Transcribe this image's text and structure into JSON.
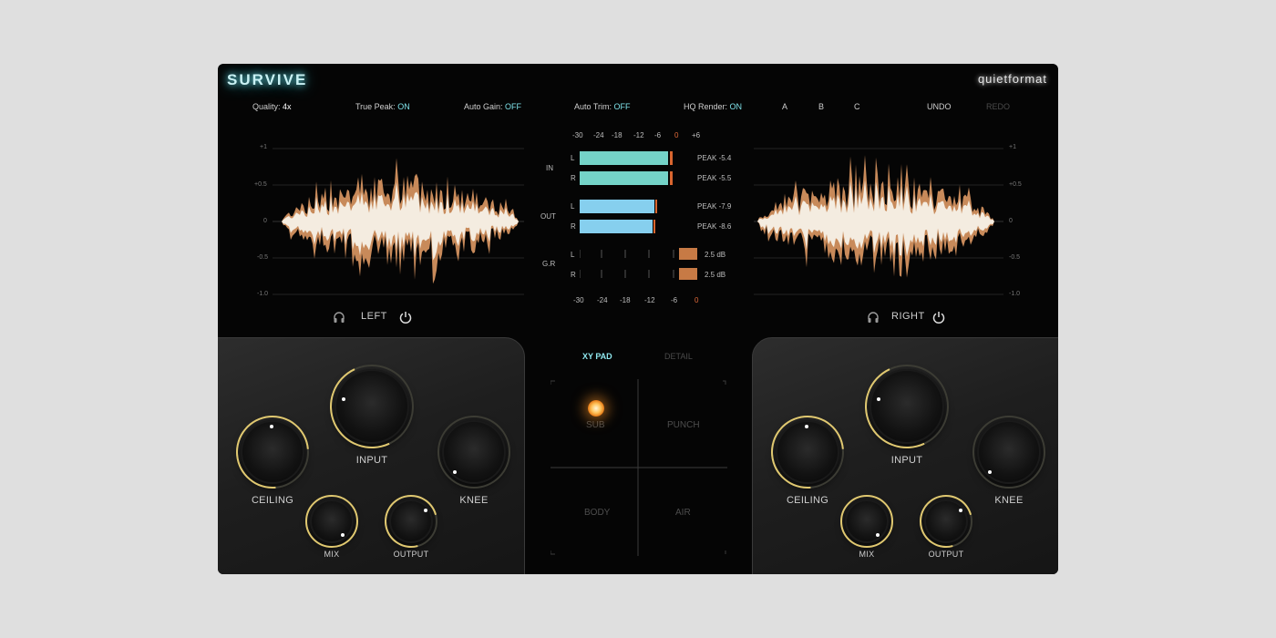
{
  "app": {
    "title": "SURVIVE",
    "brand": "quietformat"
  },
  "toolbar": {
    "quality": {
      "label": "Quality:",
      "value": "4x"
    },
    "true_peak": {
      "label": "True Peak:",
      "value": "ON"
    },
    "auto_gain": {
      "label": "Auto Gain:",
      "value": "OFF"
    },
    "auto_trim": {
      "label": "Auto Trim:",
      "value": "OFF"
    },
    "hq_render": {
      "label": "HQ Render:",
      "value": "ON"
    },
    "presets": [
      "A",
      "B",
      "C"
    ],
    "undo": "UNDO",
    "redo": "REDO"
  },
  "waveform": {
    "scale": [
      "+1",
      "+0.5",
      "0",
      "-0.5",
      "-1.0"
    ],
    "left_label": "LEFT",
    "right_label": "RIGHT"
  },
  "meters": {
    "scale_top": [
      "-30",
      "-24",
      "-18",
      "-12",
      "-6",
      "0",
      "+6"
    ],
    "scale_bottom": [
      "-30",
      "-24",
      "-18",
      "-12",
      "-6",
      "0"
    ],
    "in_label": "IN",
    "out_label": "OUT",
    "gr_label": "G.R",
    "ch_l": "L",
    "ch_r": "R",
    "in_l_peak": "PEAK -5.4",
    "in_r_peak": "PEAK -5.5",
    "out_l_peak": "PEAK -7.9",
    "out_r_peak": "PEAK -8.6",
    "gr_l": "2.5 dB",
    "gr_r": "2.5 dB",
    "colors": {
      "in": "#74d3c8",
      "out": "#86cfee",
      "gr": "#c77a45",
      "zero": "#e06a3a"
    }
  },
  "xy": {
    "tab_xy": "XY PAD",
    "tab_detail": "DETAIL",
    "sub": "SUB",
    "punch": "PUNCH",
    "body": "BODY",
    "air": "AIR"
  },
  "knobs": {
    "input": "INPUT",
    "ceiling": "CEILING",
    "knee": "KNEE",
    "mix": "MIX",
    "output": "OUTPUT"
  },
  "icons": {
    "headphones": "headphones-icon",
    "power": "power-icon"
  },
  "colors": {
    "accent": "#7fe3ea",
    "knob_ring": "#e0c870",
    "waveform_core": "#f4ece0",
    "waveform_edge": "#c88a5a"
  }
}
